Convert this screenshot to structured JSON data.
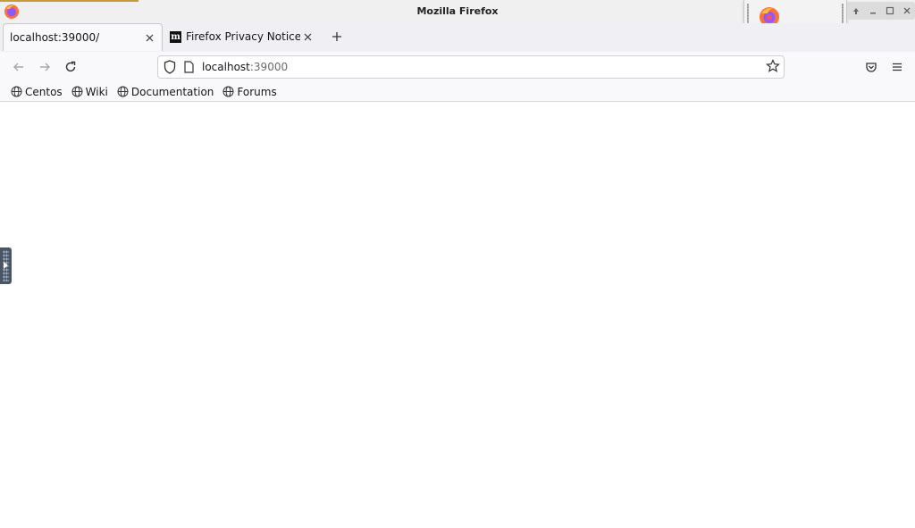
{
  "window": {
    "title": "Mozilla Firefox"
  },
  "tabs": [
    {
      "label": "localhost:39000/",
      "active": true
    },
    {
      "label": "Firefox Privacy Notice —",
      "active": false
    }
  ],
  "urlbar": {
    "host": "localhost",
    "port": ":39000"
  },
  "bookmarks": [
    {
      "label": "Centos"
    },
    {
      "label": "Wiki"
    },
    {
      "label": "Documentation"
    },
    {
      "label": "Forums"
    }
  ],
  "icons": {
    "app": "firefox-icon",
    "back": "back-arrow-icon",
    "forward": "forward-arrow-icon",
    "reload": "reload-icon",
    "shield": "shield-icon",
    "page": "page-icon",
    "star": "star-icon",
    "pocket": "pocket-icon",
    "menu": "hamburger-menu-icon",
    "globe": "globe-icon",
    "close": "close-icon",
    "new_tab": "plus-icon"
  },
  "colors": {
    "accent": "#c79a3a",
    "handle": "#4a5666"
  }
}
